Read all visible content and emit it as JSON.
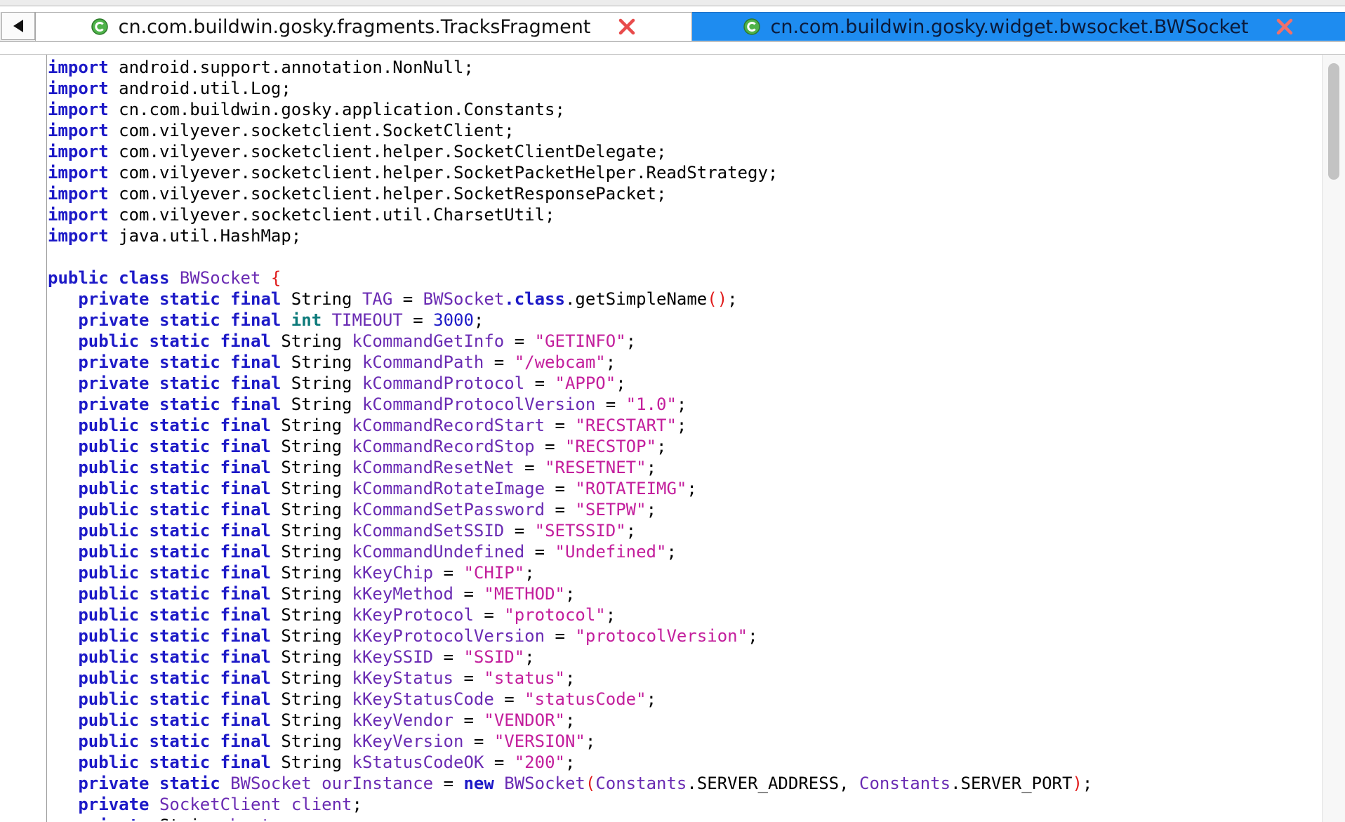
{
  "tabs": [
    {
      "label": "cn.com.buildwin.gosky.fragments.TracksFragment",
      "active": false,
      "icon": "class-icon",
      "close_icon": "close-icon"
    },
    {
      "label": "cn.com.buildwin.gosky.widget.bwsocket.BWSocket",
      "active": true,
      "icon": "class-icon",
      "close_icon": "close-icon"
    }
  ],
  "colors": {
    "keyword": "#1c19c7",
    "primitive_type": "#0c7a7a",
    "identifier": "#6a2bb3",
    "string": "#c31e9c",
    "bracket": "#e01b1b",
    "active_tab": "#1e8cf0"
  },
  "code_lines": [
    [
      [
        "kw",
        "import"
      ],
      [
        "",
        "android.support.annotation.NonNull;"
      ]
    ],
    [
      [
        "kw",
        "import"
      ],
      [
        "",
        "android.util.Log;"
      ]
    ],
    [
      [
        "kw",
        "import"
      ],
      [
        "",
        "cn.com.buildwin.gosky.application.Constants;"
      ]
    ],
    [
      [
        "kw",
        "import"
      ],
      [
        "",
        "com.vilyever.socketclient.SocketClient;"
      ]
    ],
    [
      [
        "kw",
        "import"
      ],
      [
        "",
        "com.vilyever.socketclient.helper.SocketClientDelegate;"
      ]
    ],
    [
      [
        "kw",
        "import"
      ],
      [
        "",
        "com.vilyever.socketclient.helper.SocketPacketHelper.ReadStrategy;"
      ]
    ],
    [
      [
        "kw",
        "import"
      ],
      [
        "",
        "com.vilyever.socketclient.helper.SocketResponsePacket;"
      ]
    ],
    [
      [
        "kw",
        "import"
      ],
      [
        "",
        "com.vilyever.socketclient.util.CharsetUtil;"
      ]
    ],
    [
      [
        "kw",
        "import"
      ],
      [
        "",
        "java.util.HashMap;"
      ]
    ],
    [],
    [
      [
        "kw",
        "public class"
      ],
      [
        "id",
        "BWSocket"
      ],
      [
        "br",
        "{"
      ]
    ],
    [
      [
        "",
        "   "
      ],
      [
        "kw",
        "private static final"
      ],
      [
        "",
        "String"
      ],
      [
        "id",
        "TAG"
      ],
      [
        "",
        "="
      ],
      [
        "id",
        "BWSocket"
      ],
      [
        "kw",
        ".class"
      ],
      [
        ".",
        ".getSimpleName"
      ],
      [
        "br",
        "()"
      ],
      [
        ";",
        ";"
      ]
    ],
    [
      [
        "",
        "   "
      ],
      [
        "kw",
        "private static final"
      ],
      [
        "ty",
        "int"
      ],
      [
        "id",
        "TIMEOUT"
      ],
      [
        "",
        "="
      ],
      [
        "num",
        "3000"
      ],
      [
        ";",
        ";"
      ]
    ],
    [
      [
        "",
        "   "
      ],
      [
        "kw",
        "public static final"
      ],
      [
        "",
        "String"
      ],
      [
        "id",
        "kCommandGetInfo"
      ],
      [
        "",
        "="
      ],
      [
        "str",
        "\"GETINFO\""
      ],
      [
        ";",
        ";"
      ]
    ],
    [
      [
        "",
        "   "
      ],
      [
        "kw",
        "private static final"
      ],
      [
        "",
        "String"
      ],
      [
        "id",
        "kCommandPath"
      ],
      [
        "",
        "="
      ],
      [
        "str",
        "\"/webcam\""
      ],
      [
        ";",
        ";"
      ]
    ],
    [
      [
        "",
        "   "
      ],
      [
        "kw",
        "private static final"
      ],
      [
        "",
        "String"
      ],
      [
        "id",
        "kCommandProtocol"
      ],
      [
        "",
        "="
      ],
      [
        "str",
        "\"APPO\""
      ],
      [
        ";",
        ";"
      ]
    ],
    [
      [
        "",
        "   "
      ],
      [
        "kw",
        "private static final"
      ],
      [
        "",
        "String"
      ],
      [
        "id",
        "kCommandProtocolVersion"
      ],
      [
        "",
        "="
      ],
      [
        "str",
        "\"1.0\""
      ],
      [
        ";",
        ";"
      ]
    ],
    [
      [
        "",
        "   "
      ],
      [
        "kw",
        "public static final"
      ],
      [
        "",
        "String"
      ],
      [
        "id",
        "kCommandRecordStart"
      ],
      [
        "",
        "="
      ],
      [
        "str",
        "\"RECSTART\""
      ],
      [
        ";",
        ";"
      ]
    ],
    [
      [
        "",
        "   "
      ],
      [
        "kw",
        "public static final"
      ],
      [
        "",
        "String"
      ],
      [
        "id",
        "kCommandRecordStop"
      ],
      [
        "",
        "="
      ],
      [
        "str",
        "\"RECSTOP\""
      ],
      [
        ";",
        ";"
      ]
    ],
    [
      [
        "",
        "   "
      ],
      [
        "kw",
        "public static final"
      ],
      [
        "",
        "String"
      ],
      [
        "id",
        "kCommandResetNet"
      ],
      [
        "",
        "="
      ],
      [
        "str",
        "\"RESETNET\""
      ],
      [
        ";",
        ";"
      ]
    ],
    [
      [
        "",
        "   "
      ],
      [
        "kw",
        "public static final"
      ],
      [
        "",
        "String"
      ],
      [
        "id",
        "kCommandRotateImage"
      ],
      [
        "",
        "="
      ],
      [
        "str",
        "\"ROTATEIMG\""
      ],
      [
        ";",
        ";"
      ]
    ],
    [
      [
        "",
        "   "
      ],
      [
        "kw",
        "public static final"
      ],
      [
        "",
        "String"
      ],
      [
        "id",
        "kCommandSetPassword"
      ],
      [
        "",
        "="
      ],
      [
        "str",
        "\"SETPW\""
      ],
      [
        ";",
        ";"
      ]
    ],
    [
      [
        "",
        "   "
      ],
      [
        "kw",
        "public static final"
      ],
      [
        "",
        "String"
      ],
      [
        "id",
        "kCommandSetSSID"
      ],
      [
        "",
        "="
      ],
      [
        "str",
        "\"SETSSID\""
      ],
      [
        ";",
        ";"
      ]
    ],
    [
      [
        "",
        "   "
      ],
      [
        "kw",
        "public static final"
      ],
      [
        "",
        "String"
      ],
      [
        "id",
        "kCommandUndefined"
      ],
      [
        "",
        "="
      ],
      [
        "str",
        "\"Undefined\""
      ],
      [
        ";",
        ";"
      ]
    ],
    [
      [
        "",
        "   "
      ],
      [
        "kw",
        "public static final"
      ],
      [
        "",
        "String"
      ],
      [
        "id",
        "kKeyChip"
      ],
      [
        "",
        "="
      ],
      [
        "str",
        "\"CHIP\""
      ],
      [
        ";",
        ";"
      ]
    ],
    [
      [
        "",
        "   "
      ],
      [
        "kw",
        "public static final"
      ],
      [
        "",
        "String"
      ],
      [
        "id",
        "kKeyMethod"
      ],
      [
        "",
        "="
      ],
      [
        "str",
        "\"METHOD\""
      ],
      [
        ";",
        ";"
      ]
    ],
    [
      [
        "",
        "   "
      ],
      [
        "kw",
        "public static final"
      ],
      [
        "",
        "String"
      ],
      [
        "id",
        "kKeyProtocol"
      ],
      [
        "",
        "="
      ],
      [
        "str",
        "\"protocol\""
      ],
      [
        ";",
        ";"
      ]
    ],
    [
      [
        "",
        "   "
      ],
      [
        "kw",
        "public static final"
      ],
      [
        "",
        "String"
      ],
      [
        "id",
        "kKeyProtocolVersion"
      ],
      [
        "",
        "="
      ],
      [
        "str",
        "\"protocolVersion\""
      ],
      [
        ";",
        ";"
      ]
    ],
    [
      [
        "",
        "   "
      ],
      [
        "kw",
        "public static final"
      ],
      [
        "",
        "String"
      ],
      [
        "id",
        "kKeySSID"
      ],
      [
        "",
        "="
      ],
      [
        "str",
        "\"SSID\""
      ],
      [
        ";",
        ";"
      ]
    ],
    [
      [
        "",
        "   "
      ],
      [
        "kw",
        "public static final"
      ],
      [
        "",
        "String"
      ],
      [
        "id",
        "kKeyStatus"
      ],
      [
        "",
        "="
      ],
      [
        "str",
        "\"status\""
      ],
      [
        ";",
        ";"
      ]
    ],
    [
      [
        "",
        "   "
      ],
      [
        "kw",
        "public static final"
      ],
      [
        "",
        "String"
      ],
      [
        "id",
        "kKeyStatusCode"
      ],
      [
        "",
        "="
      ],
      [
        "str",
        "\"statusCode\""
      ],
      [
        ";",
        ";"
      ]
    ],
    [
      [
        "",
        "   "
      ],
      [
        "kw",
        "public static final"
      ],
      [
        "",
        "String"
      ],
      [
        "id",
        "kKeyVendor"
      ],
      [
        "",
        "="
      ],
      [
        "str",
        "\"VENDOR\""
      ],
      [
        ";",
        ";"
      ]
    ],
    [
      [
        "",
        "   "
      ],
      [
        "kw",
        "public static final"
      ],
      [
        "",
        "String"
      ],
      [
        "id",
        "kKeyVersion"
      ],
      [
        "",
        "="
      ],
      [
        "str",
        "\"VERSION\""
      ],
      [
        ";",
        ";"
      ]
    ],
    [
      [
        "",
        "   "
      ],
      [
        "kw",
        "public static final"
      ],
      [
        "",
        "String"
      ],
      [
        "id",
        "kStatusCodeOK"
      ],
      [
        "",
        "="
      ],
      [
        "str",
        "\"200\""
      ],
      [
        ";",
        ";"
      ]
    ],
    [
      [
        "",
        "   "
      ],
      [
        "kw",
        "private static"
      ],
      [
        "id",
        "BWSocket"
      ],
      [
        "id",
        "ourInstance"
      ],
      [
        "",
        "="
      ],
      [
        "kw",
        "new"
      ],
      [
        "id",
        "BWSocket"
      ],
      [
        "br",
        "("
      ],
      [
        "id",
        "Constants"
      ],
      [
        ".",
        ".SERVER_ADDRESS,"
      ],
      [
        "id",
        "Constants"
      ],
      [
        ".",
        ".SERVER_PORT"
      ],
      [
        "br",
        ")"
      ],
      [
        ";",
        ";"
      ]
    ],
    [
      [
        "",
        "   "
      ],
      [
        "kw",
        "private"
      ],
      [
        "id",
        "SocketClient"
      ],
      [
        "id",
        "client"
      ],
      [
        ";",
        ";"
      ]
    ],
    [
      [
        "",
        "   "
      ],
      [
        "kw",
        "private"
      ],
      [
        "",
        "String"
      ],
      [
        "id",
        "host"
      ],
      [
        ";",
        ";"
      ]
    ]
  ]
}
